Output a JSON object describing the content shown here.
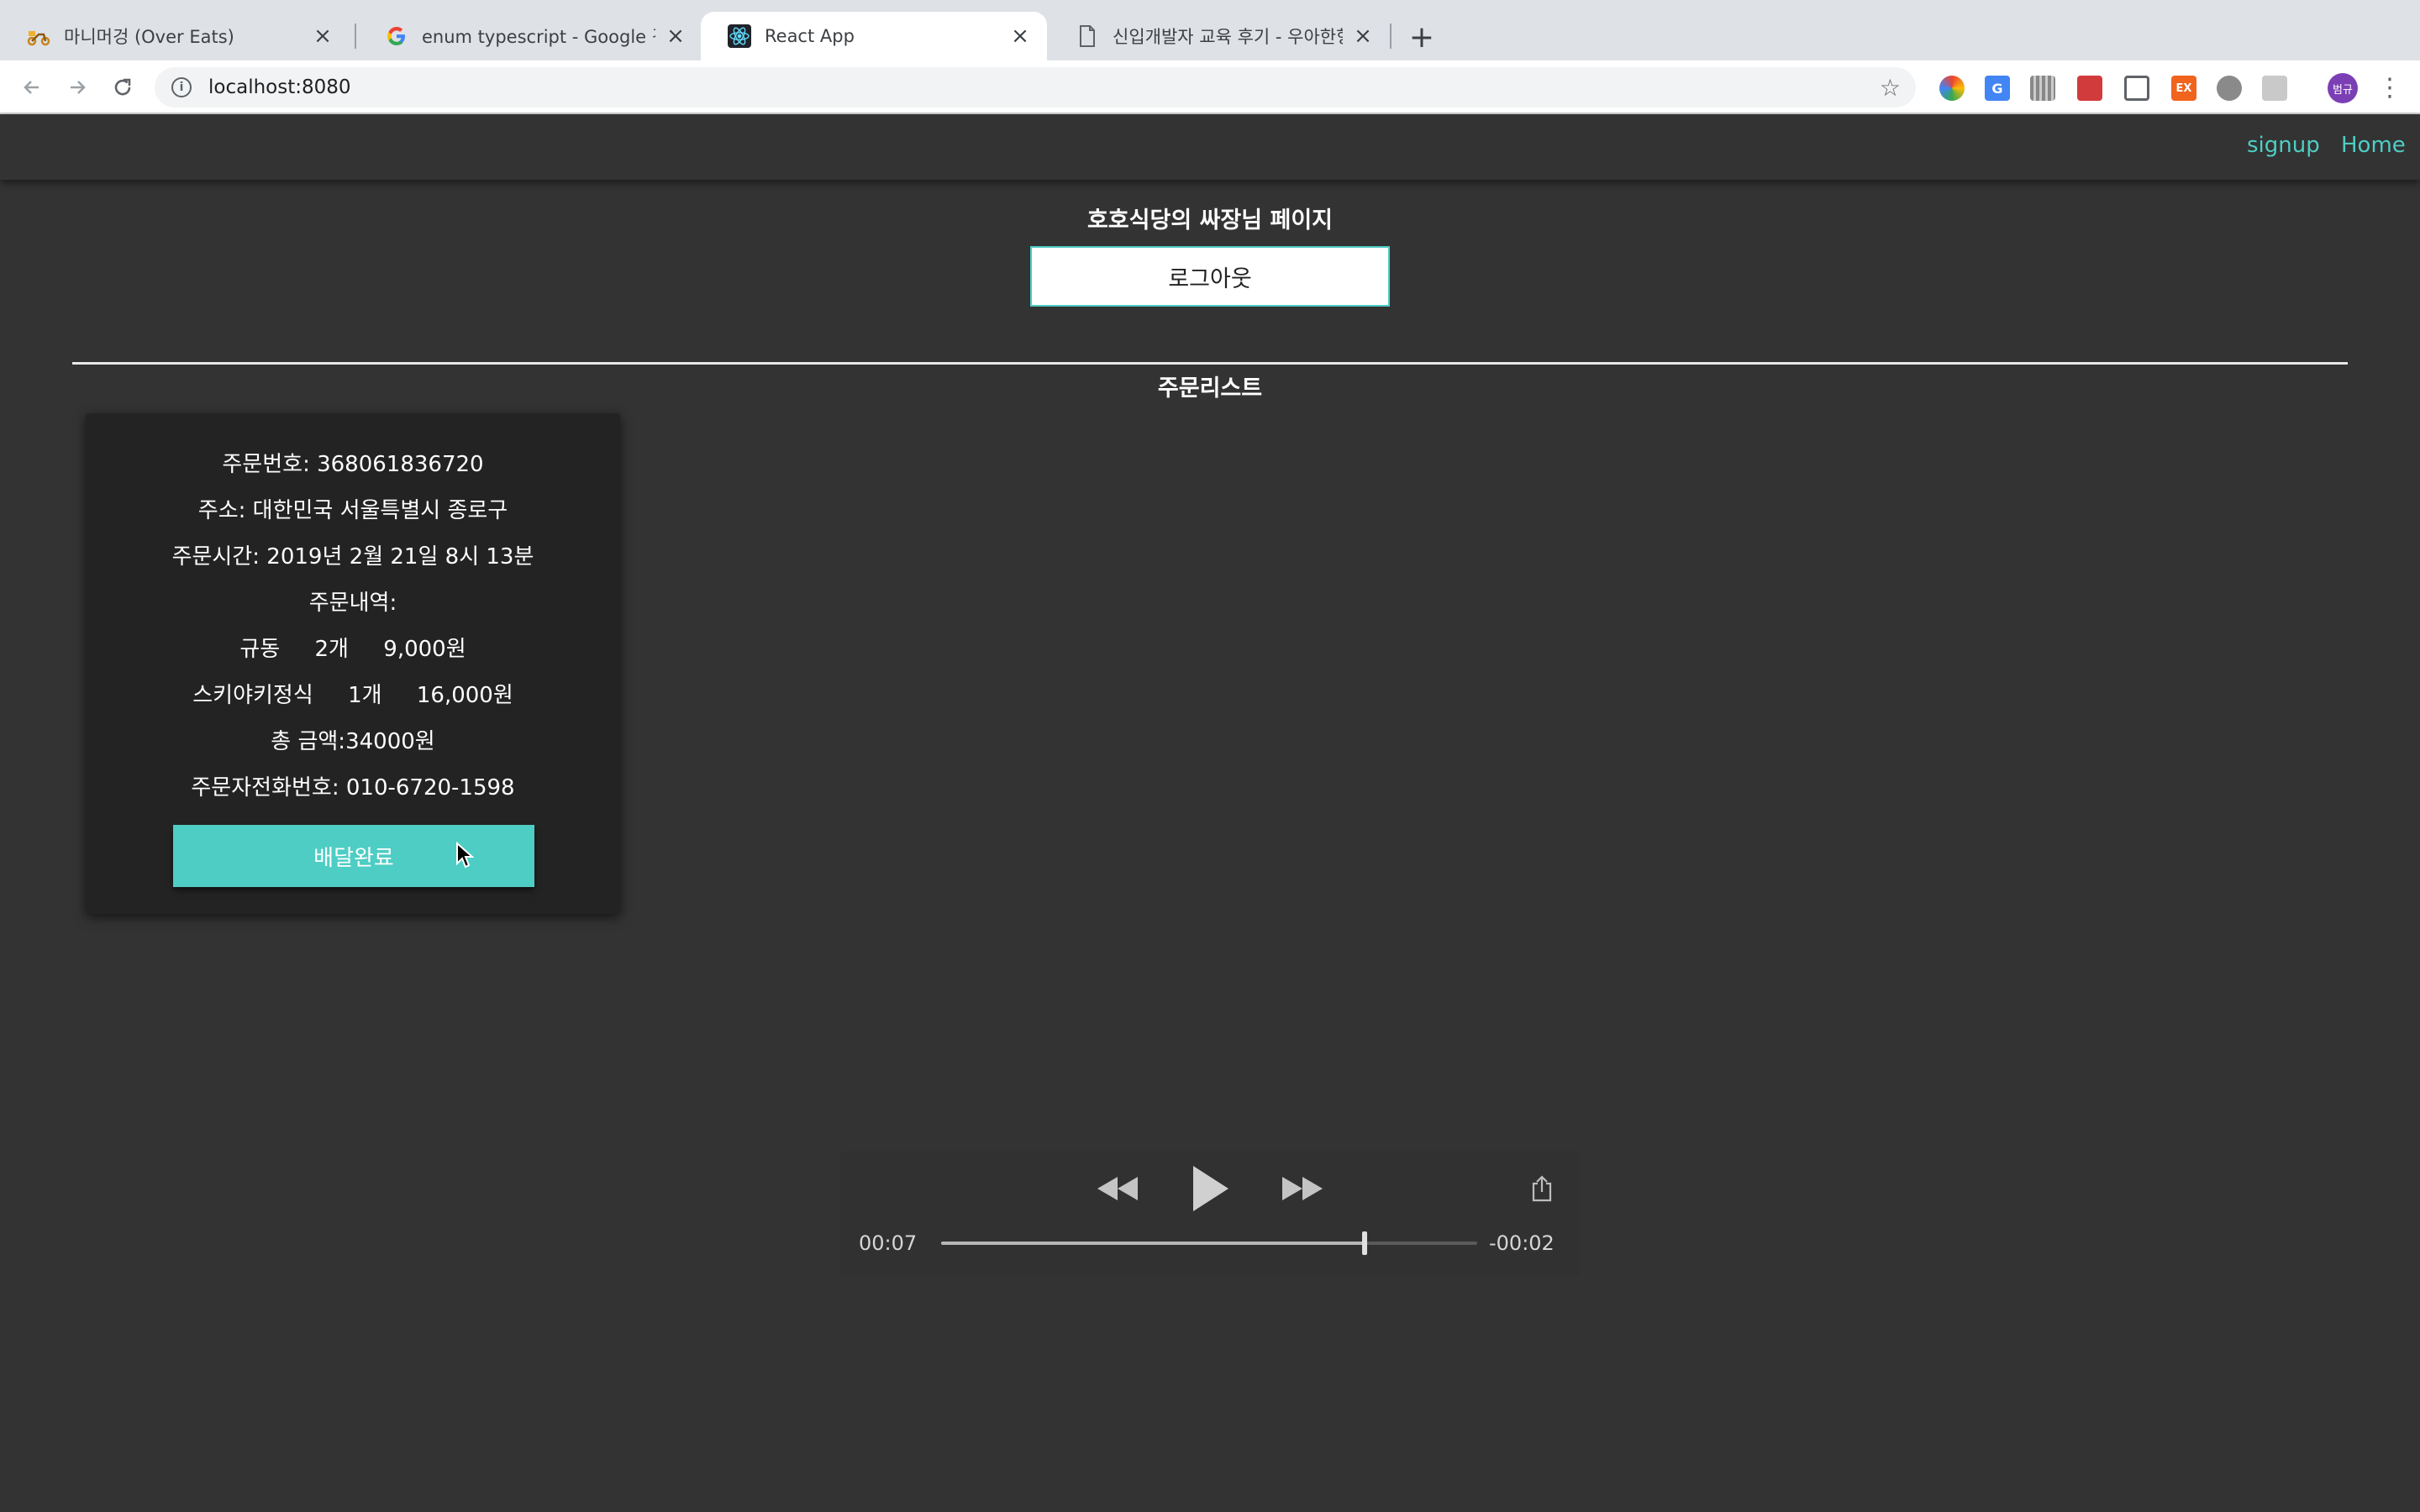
{
  "browser": {
    "tabs": [
      {
        "title": "마니머겅 (Over Eats)",
        "icon": "scooter-icon"
      },
      {
        "title": "enum typescript - Google 검색",
        "icon": "google-icon"
      },
      {
        "title": "React App",
        "icon": "react-icon"
      },
      {
        "title": "신입개발자 교육 후기 - 우아한형제들",
        "icon": "document-icon"
      }
    ],
    "url": "localhost:8080",
    "profile_initials": "범규"
  },
  "nav": {
    "signup": "signup",
    "home": "Home"
  },
  "page": {
    "title": "호호식당의 싸장님 페이지",
    "logout_label": "로그아웃",
    "order_list_title": "주문리스트"
  },
  "order": {
    "number": "주문번호: 368061836720",
    "address": "주소: 대한민국 서울특별시 종로구",
    "time": "주문시간: 2019년 2월 21일 8시 13분",
    "items_label": "주문내역:",
    "items": [
      "규동     2개     9,000원",
      "스키야키정식     1개     16,000원"
    ],
    "total": "총 금액:34000원",
    "phone": "주문자전화번호: 010-6720-1598",
    "done_label": "배달완료"
  },
  "player": {
    "elapsed": "00:07",
    "remaining": "-00:02",
    "progress": 0.79
  },
  "colors": {
    "accent": "#4ecdc4",
    "background": "#333333",
    "card": "#232323"
  }
}
